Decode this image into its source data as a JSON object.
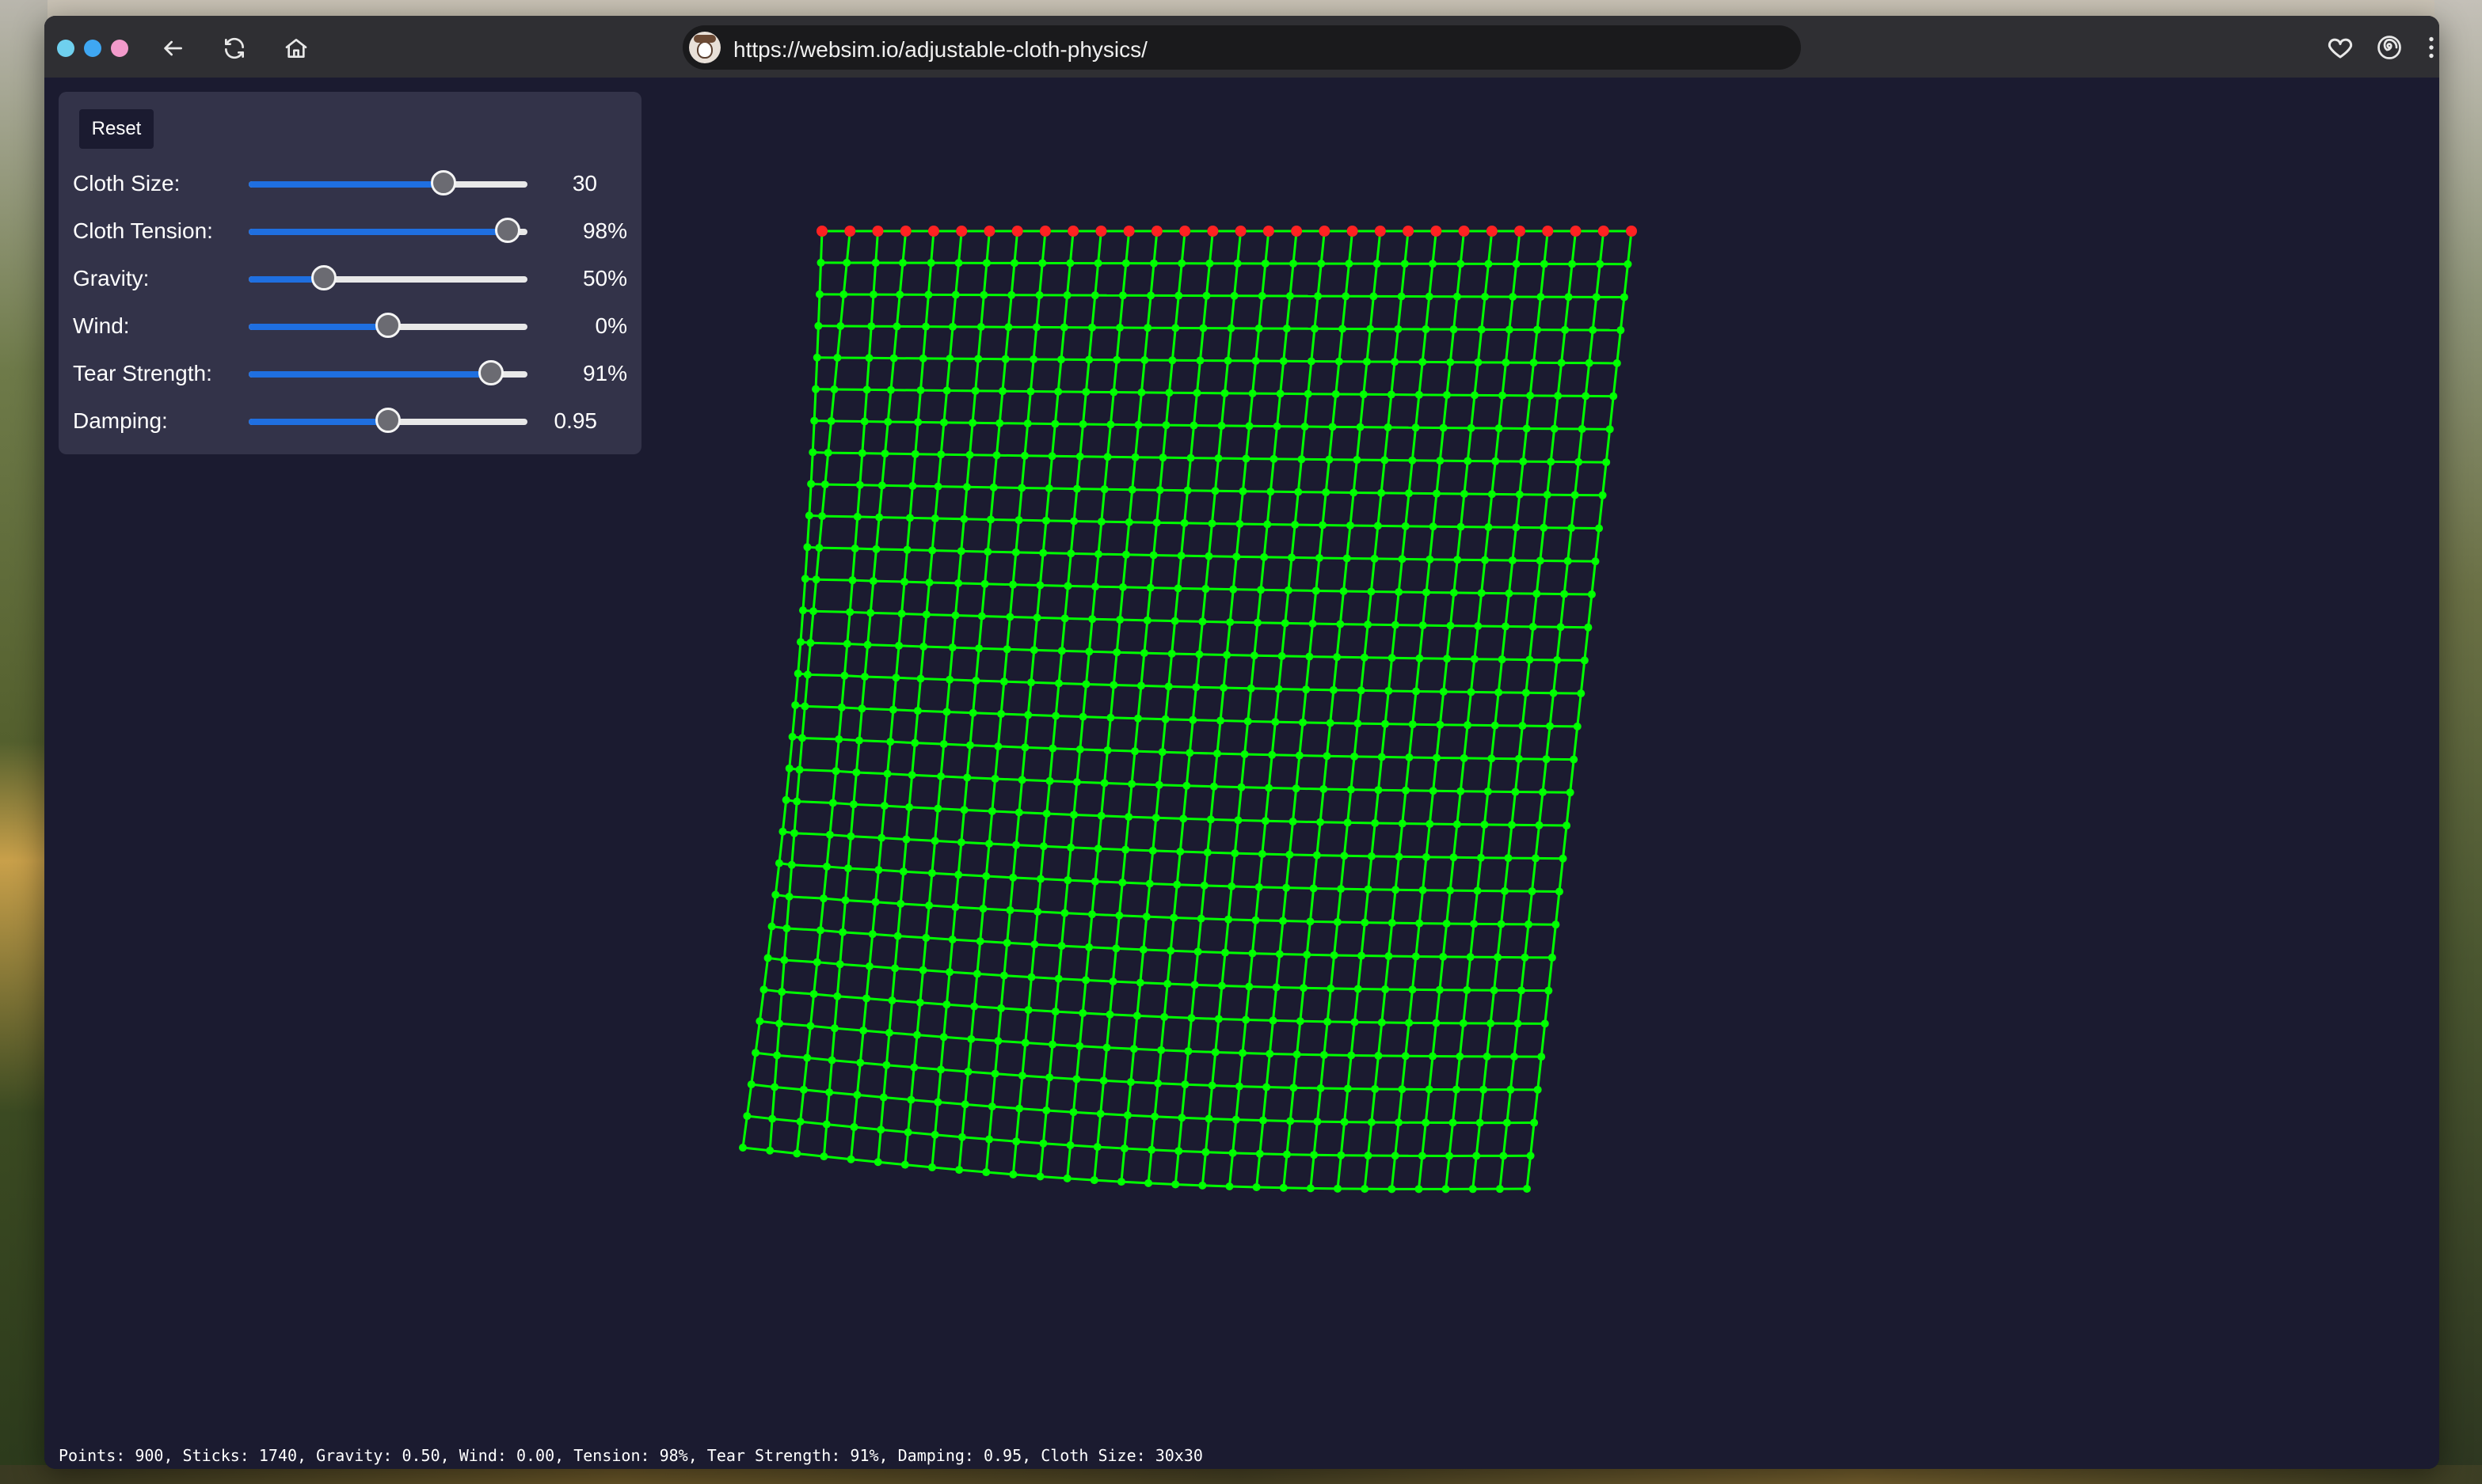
{
  "browser": {
    "url": "https://websim.io/adjustable-cloth-physics/"
  },
  "controls": {
    "reset_label": "Reset",
    "sliders": [
      {
        "label": "Cloth Size:",
        "display": "30",
        "fraction": 0.7
      },
      {
        "label": "Cloth Tension:",
        "display": "98%",
        "fraction": 0.93
      },
      {
        "label": "Gravity:",
        "display": "50%",
        "fraction": 0.27
      },
      {
        "label": "Wind:",
        "display": "0%",
        "fraction": 0.5
      },
      {
        "label": "Tear Strength:",
        "display": "91%",
        "fraction": 0.87
      },
      {
        "label": "Damping:",
        "display": "0.95",
        "fraction": 0.5
      }
    ]
  },
  "cloth": {
    "grid_size": 30,
    "colors": {
      "stick": "#00ff00",
      "pinned": "#ff2222",
      "point": "#00ff00"
    }
  },
  "status_text": "Points: 900, Sticks: 1740, Gravity: 0.50, Wind: 0.00, Tension: 98%, Tear Strength: 91%, Damping: 0.95, Cloth Size: 30x30",
  "colors": {
    "accent": "#1f6fe0",
    "canvas_bg": "#1b1b30",
    "panel_bg": "#333349"
  }
}
